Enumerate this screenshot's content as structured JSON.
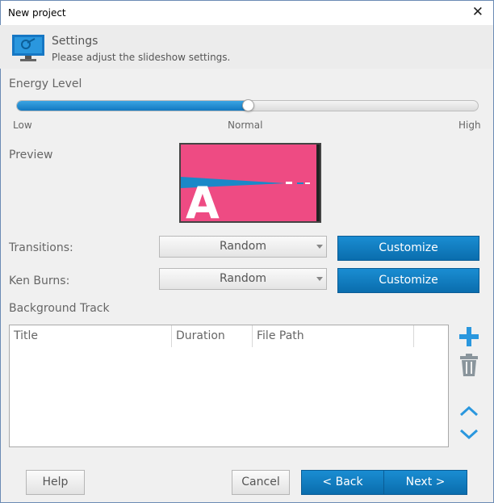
{
  "window": {
    "title": "New project"
  },
  "header": {
    "title": "Settings",
    "subtitle": "Please adjust the slideshow settings."
  },
  "energy": {
    "label": "Energy Level",
    "low_label": "Low",
    "normal_label": "Normal",
    "high_label": "High",
    "level": 0.5
  },
  "preview": {
    "label": "Preview",
    "letter": "A"
  },
  "transitions": {
    "label": "Transitions:",
    "value": "Random",
    "customize_label": "Customize"
  },
  "ken_burns": {
    "label": "Ken Burns:",
    "value": "Random",
    "customize_label": "Customize"
  },
  "background_track": {
    "label": "Background Track",
    "columns": [
      "Title",
      "Duration",
      "File Path"
    ],
    "rows": []
  },
  "buttons": {
    "help": "Help",
    "cancel": "Cancel",
    "back": "< Back",
    "next": "Next >"
  },
  "colors": {
    "accent": "#1379c1",
    "preview_bg": "#ee4b83",
    "icon_blue": "#2a97de",
    "trash_gray": "#8a959c"
  }
}
